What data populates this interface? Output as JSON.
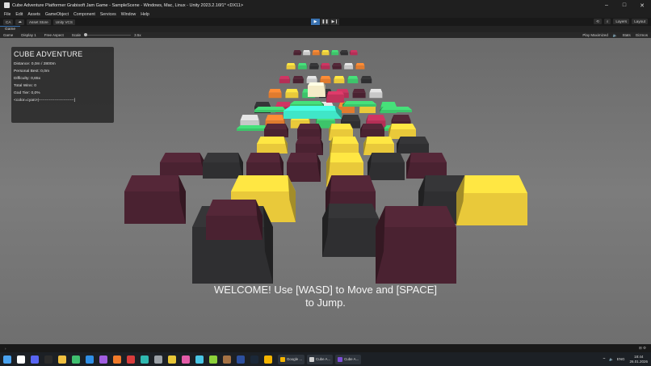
{
  "window": {
    "title": "Cube Adventure Platformer Grabisoft Jam Game - SampleScene - Windows, Mac, Linux - Unity 2023.2.16f1* <DX11>",
    "minimize": "–",
    "maximize": "□",
    "close": "✕"
  },
  "menu": [
    "File",
    "Edit",
    "Assets",
    "GameObject",
    "Component",
    "Services",
    "Window",
    "Help"
  ],
  "toolbar": {
    "account": "CA",
    "asset_store": "Asset Store",
    "vcs": "Unity VCS",
    "play": "▶",
    "pause": "❚❚",
    "step": "▶❙",
    "layers": "Layers",
    "layout": "Layout"
  },
  "tabs": {
    "game": "Game"
  },
  "game_bar": {
    "view": "Game",
    "display": "Display 1",
    "aspect": "Free Aspect",
    "scale_label": "Scale",
    "scale_value": "3.5x",
    "play_mode": "Play Maximized",
    "stats": "Stats",
    "gizmos": "Gizmos"
  },
  "hud": {
    "title": "CUBE ADVENTURE",
    "distance": "Distance: 0,0m / 2800m",
    "personal_best": "Personal Best: 0,0m",
    "difficulty": "Difficulty: 0,65x",
    "total_wins": "Total Wins: 0",
    "god_tier": "God Tier: 0,0%",
    "progress_bar": "<color=cyan>|---------------------------]"
  },
  "welcome": {
    "line1": "WELCOME! Use [WASD] to Move and [SPACE]",
    "line2": "to Jump."
  },
  "console": {
    "right": "⊞ ⚙"
  },
  "taskbar": {
    "apps": [
      {
        "name": "start",
        "color": "#4aa3f0"
      },
      {
        "name": "search",
        "color": "#ffffff"
      },
      {
        "name": "discord",
        "color": "#5865f2"
      },
      {
        "name": "terminal",
        "color": "#2b2b2b"
      },
      {
        "name": "files",
        "color": "#f0c040"
      },
      {
        "name": "app-green",
        "color": "#3fbf6f"
      },
      {
        "name": "app-blue",
        "color": "#2f8fe6"
      },
      {
        "name": "app-purple",
        "color": "#a05de0"
      },
      {
        "name": "app-orange",
        "color": "#f07a2a"
      },
      {
        "name": "app-red",
        "color": "#d93c3c"
      },
      {
        "name": "app-teal",
        "color": "#2fb8b0"
      },
      {
        "name": "app-gray",
        "color": "#9aa0a6"
      },
      {
        "name": "app-yellow",
        "color": "#e8c637"
      },
      {
        "name": "app-pink",
        "color": "#e35ca8"
      },
      {
        "name": "app-cyan",
        "color": "#49c6e5"
      },
      {
        "name": "app-lime",
        "color": "#8cd13a"
      },
      {
        "name": "app-brown",
        "color": "#a57244"
      },
      {
        "name": "app-navy",
        "color": "#2c4f9e"
      },
      {
        "name": "app-steam",
        "color": "#1b2838"
      },
      {
        "name": "app-chrome",
        "color": "#f4b400"
      }
    ],
    "open_windows": [
      {
        "label": "Google ...",
        "color": "#f4b400"
      },
      {
        "label": "Cube A...",
        "color": "#cfcfcf"
      },
      {
        "label": "Cube A...",
        "color": "#7c4dd6"
      }
    ],
    "tray_lang": "ENG",
    "time": "18:44",
    "date": "26.01.2026"
  },
  "colors": {
    "dark_maroon": "#4a2231",
    "dark_gray": "#2f2f31",
    "yellow": "#e9c93a",
    "green": "#3dc46a",
    "cyan": "#40e6c8",
    "accent": "#3a72b0"
  }
}
